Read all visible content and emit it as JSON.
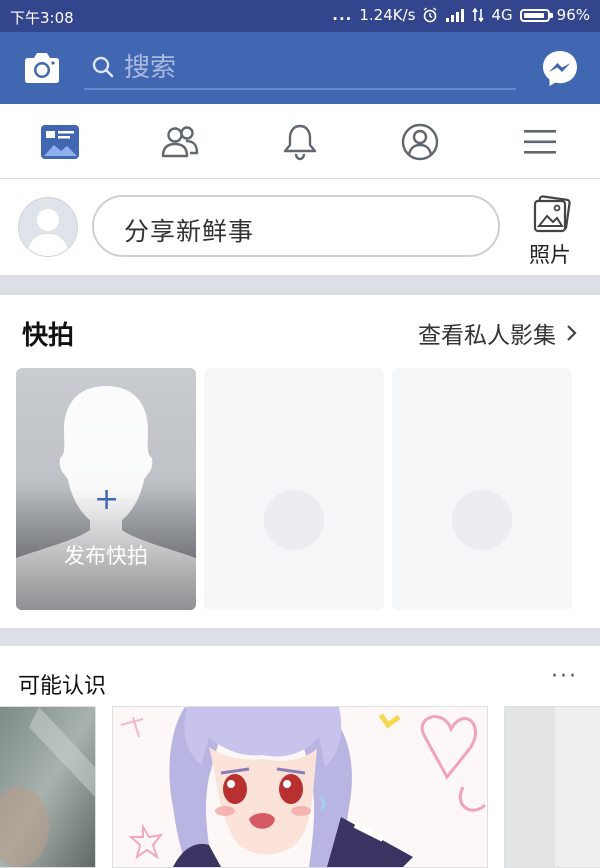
{
  "status_bar": {
    "time": "下午3:08",
    "dots": "...",
    "network_speed": "1.24K/s",
    "network_type": "4G",
    "battery": "96%"
  },
  "header": {
    "search_placeholder": "搜索"
  },
  "nav_tabs": [
    "news-feed",
    "friends",
    "notifications",
    "profile",
    "menu"
  ],
  "composer": {
    "prompt": "分享新鲜事",
    "photo_label": "照片"
  },
  "stories": {
    "title": "快拍",
    "archive_link": "查看私人影集",
    "add_label": "发布快拍",
    "add_symbol": "+"
  },
  "people_you_may_know": {
    "title": "可能认识",
    "more": "···"
  },
  "colors": {
    "status_bar": "#33458c",
    "header": "#4267b2",
    "separator": "#dcdfe5",
    "accent": "#4267b2"
  }
}
